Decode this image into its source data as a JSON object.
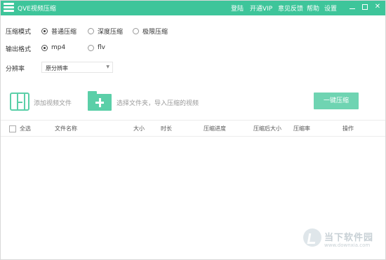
{
  "titlebar": {
    "title": "QVE视频压缩",
    "menu": [
      "登陆",
      "开通VIP",
      "意见反馈",
      "帮助",
      "设置"
    ],
    "window_controls": [
      "minimize",
      "maximize",
      "close"
    ]
  },
  "settings": {
    "mode_label": "压缩模式",
    "mode_options": [
      "普通压缩",
      "深度压缩",
      "极限压缩"
    ],
    "mode_selected": "普通压缩",
    "format_label": "输出格式",
    "format_options": [
      "mp4",
      "flv"
    ],
    "format_selected": "mp4",
    "resolution_label": "分辨率",
    "resolution_value": "原分辨率"
  },
  "actions": {
    "add_file": "添加视频文件",
    "add_folder": "选择文件夹，导入压缩的视频",
    "compress": "一键压缩"
  },
  "table": {
    "select_all": "全选",
    "columns": [
      "文件名称",
      "大小",
      "时长",
      "压缩进度",
      "压缩后大小",
      "压缩率",
      "操作"
    ],
    "rows": []
  },
  "watermark": {
    "title": "当下软件园",
    "url": "www.downxia.com"
  },
  "colors": {
    "accent": "#3ec59a",
    "button": "#6fd4b2",
    "icon": "#5bcfa8"
  }
}
